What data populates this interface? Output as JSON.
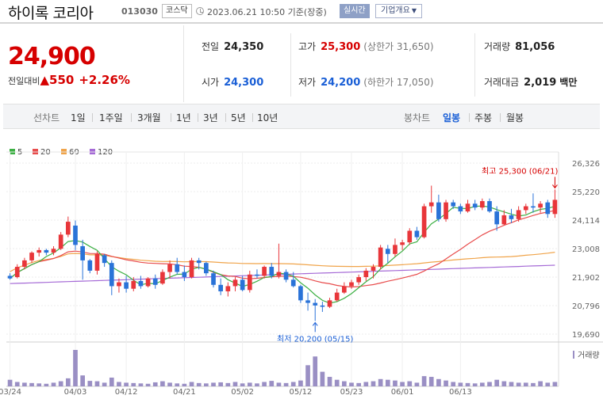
{
  "header": {
    "name": "하이록 코리아",
    "code": "013030",
    "market": "코스닥",
    "date": "2023.06.21 10:50 기준(장중)",
    "realtime_label": "실시간",
    "company_label": "기업개요"
  },
  "summary": {
    "price": "24,900",
    "change_label": "전일대비",
    "change_arrow": "▲",
    "change": "550",
    "change_pct": "+2.26%",
    "prev_close_label": "전일",
    "prev_close": "24,350",
    "open_label": "시가",
    "open": "24,300",
    "high_label": "고가",
    "high": "25,300",
    "high_limit": "(상한가 31,650)",
    "low_label": "저가",
    "low": "24,200",
    "low_limit": "(하한가 17,050)",
    "volume_label": "거래량",
    "volume": "81,056",
    "amount_label": "거래대금",
    "amount": "2,019",
    "amount_unit": "백만"
  },
  "periods": {
    "line_label": "선차트",
    "line_items": [
      "1일",
      "1주일",
      "3개월",
      "1년",
      "3년",
      "5년",
      "10년"
    ],
    "candle_label": "봉차트",
    "candle_items": [
      "일봉",
      "주봉",
      "월봉"
    ],
    "active_candle": "일봉"
  },
  "colors": {
    "up": "#e8363a",
    "down": "#2a73d8",
    "ma5": "#3cb043",
    "ma20": "#e84c4c",
    "ma60": "#f0a44a",
    "ma120": "#a56ad6",
    "volume": "#9a8fc4"
  },
  "chart_data": {
    "type": "candlestick",
    "legend": [
      {
        "name": "5",
        "color": "#3cb043"
      },
      {
        "name": "20",
        "color": "#e84c4c"
      },
      {
        "name": "60",
        "color": "#f0a44a"
      },
      {
        "name": "120",
        "color": "#a56ad6"
      }
    ],
    "y_ticks": [
      "26,326",
      "25,220",
      "24,114",
      "23,008",
      "21,902",
      "20,796",
      "19,690"
    ],
    "ylim": [
      19690,
      26326
    ],
    "x_ticks": [
      "03/24",
      "04/03",
      "04/12",
      "04/21",
      "05/02",
      "05/12",
      "05/23",
      "06/01",
      "06/13"
    ],
    "volume_label": "거래량",
    "annotations": {
      "high": "최고 25,300 (06/21)",
      "low": "최저 20,200 (05/15)"
    },
    "candles": [
      [
        21950,
        22050,
        21800,
        21850
      ],
      [
        21900,
        22400,
        21850,
        22300
      ],
      [
        22300,
        22650,
        22200,
        22550
      ],
      [
        22550,
        22900,
        22450,
        22850
      ],
      [
        22850,
        23050,
        22700,
        22950
      ],
      [
        22950,
        23000,
        22750,
        22850
      ],
      [
        22850,
        23100,
        22750,
        23000
      ],
      [
        23000,
        23650,
        22950,
        23550
      ],
      [
        23550,
        24250,
        23450,
        24050
      ],
      [
        23900,
        24100,
        22950,
        23150
      ],
      [
        23100,
        23350,
        21800,
        22550
      ],
      [
        22550,
        22600,
        22050,
        22150
      ],
      [
        22150,
        22900,
        22000,
        22800
      ],
      [
        22750,
        22800,
        22300,
        22450
      ],
      [
        22450,
        22550,
        21200,
        21550
      ],
      [
        21550,
        21850,
        21300,
        21700
      ],
      [
        21700,
        21950,
        21300,
        21450
      ],
      [
        21450,
        21900,
        21350,
        21750
      ],
      [
        21750,
        21950,
        21450,
        21550
      ],
      [
        21550,
        21900,
        21500,
        21850
      ],
      [
        21850,
        22000,
        21450,
        21600
      ],
      [
        21650,
        22200,
        21600,
        22100
      ],
      [
        22100,
        22550,
        21850,
        22400
      ],
      [
        22400,
        22650,
        22000,
        22100
      ],
      [
        22100,
        22350,
        21750,
        21900
      ],
      [
        21900,
        22650,
        21850,
        22550
      ],
      [
        22550,
        22650,
        22200,
        22450
      ],
      [
        22450,
        22500,
        21950,
        22050
      ],
      [
        22050,
        22150,
        21500,
        21600
      ],
      [
        21600,
        21850,
        21200,
        21350
      ],
      [
        21350,
        21700,
        21150,
        21550
      ],
      [
        21550,
        21900,
        21350,
        21800
      ],
      [
        21800,
        21950,
        21350,
        21400
      ],
      [
        21400,
        22150,
        21300,
        22000
      ],
      [
        22000,
        22200,
        21850,
        21950
      ],
      [
        21950,
        22350,
        21850,
        22300
      ],
      [
        22300,
        22450,
        21850,
        21950
      ],
      [
        21950,
        23200,
        21850,
        22100
      ],
      [
        22100,
        22200,
        21700,
        21800
      ],
      [
        21800,
        22100,
        21500,
        21550
      ],
      [
        21550,
        21600,
        20900,
        21000
      ],
      [
        21000,
        21300,
        20600,
        20900
      ],
      [
        20900,
        21050,
        20200,
        20800
      ],
      [
        20800,
        20950,
        20550,
        20750
      ],
      [
        20750,
        21100,
        20700,
        21000
      ],
      [
        21000,
        21450,
        20950,
        21300
      ],
      [
        21300,
        21700,
        21250,
        21550
      ],
      [
        21550,
        21800,
        21450,
        21700
      ],
      [
        21700,
        22000,
        21600,
        21900
      ],
      [
        21900,
        22250,
        21750,
        22150
      ],
      [
        22150,
        22400,
        21850,
        22300
      ],
      [
        22300,
        23150,
        22200,
        23050
      ],
      [
        23000,
        23150,
        22450,
        22800
      ],
      [
        22800,
        23400,
        22700,
        23150
      ],
      [
        23150,
        23350,
        22950,
        23250
      ],
      [
        23250,
        23800,
        23150,
        23700
      ],
      [
        23700,
        23850,
        23350,
        23450
      ],
      [
        23450,
        24750,
        23400,
        24650
      ],
      [
        24650,
        25450,
        24400,
        24800
      ],
      [
        24800,
        25100,
        24050,
        24150
      ],
      [
        24150,
        24900,
        24050,
        24800
      ],
      [
        24800,
        24900,
        24550,
        24650
      ],
      [
        24650,
        24750,
        24350,
        24450
      ],
      [
        24450,
        24900,
        24400,
        24750
      ],
      [
        24750,
        24900,
        24500,
        24600
      ],
      [
        24600,
        24950,
        24500,
        24850
      ],
      [
        24850,
        24950,
        24400,
        24450
      ],
      [
        24450,
        24650,
        23700,
        23950
      ],
      [
        23950,
        24500,
        23900,
        24300
      ],
      [
        24300,
        24550,
        24000,
        24150
      ],
      [
        24150,
        24650,
        24050,
        24500
      ],
      [
        24500,
        24750,
        24350,
        24650
      ],
      [
        24650,
        25150,
        24400,
        24600
      ],
      [
        24600,
        24850,
        24400,
        24750
      ],
      [
        24800,
        24900,
        24200,
        24350
      ],
      [
        24350,
        25300,
        24200,
        24900
      ]
    ],
    "volumes": [
      18,
      12,
      10,
      9,
      8,
      7,
      10,
      14,
      22,
      100,
      30,
      15,
      14,
      10,
      24,
      12,
      10,
      9,
      8,
      7,
      11,
      14,
      10,
      8,
      7,
      12,
      9,
      8,
      10,
      11,
      9,
      12,
      8,
      10,
      8,
      12,
      15,
      10,
      9,
      12,
      16,
      58,
      82,
      40,
      26,
      18,
      14,
      10,
      9,
      12,
      14,
      20,
      18,
      16,
      12,
      14,
      10,
      28,
      26,
      20,
      16,
      12,
      10,
      9,
      8,
      10,
      12,
      18,
      14,
      12,
      10,
      10,
      9,
      14,
      10,
      12
    ]
  }
}
